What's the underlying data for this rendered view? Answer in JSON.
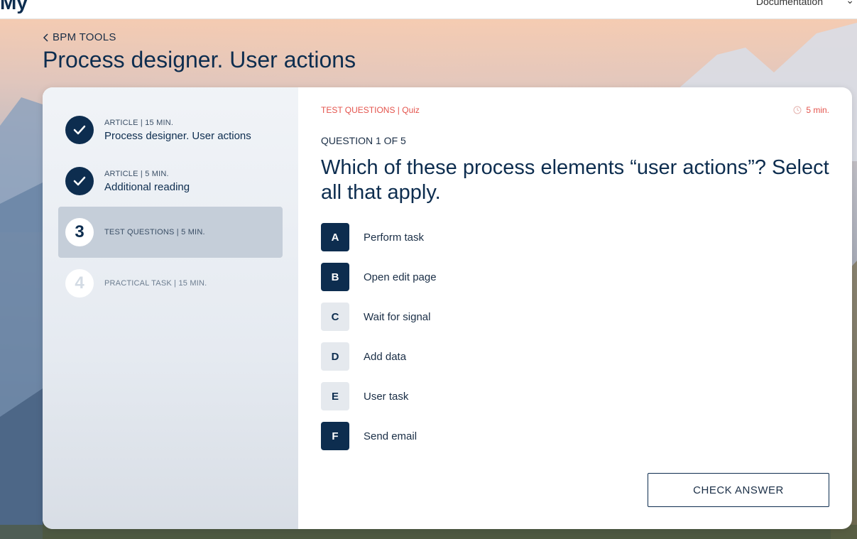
{
  "header": {
    "logo_text": "My",
    "documentation_link": "Documentation"
  },
  "breadcrumb": {
    "label": "BPM TOOLS"
  },
  "page_title": "Process designer. User actions",
  "steps": [
    {
      "kicker": "ARTICLE | 15 MIN.",
      "name": "Process designer. User actions",
      "state": "done"
    },
    {
      "kicker": "ARTICLE | 5 MIN.",
      "name": "Additional reading",
      "state": "done"
    },
    {
      "number": "3",
      "kicker": "TEST QUESTIONS | 5 MIN.",
      "state": "current"
    },
    {
      "number": "4",
      "kicker": "PRACTICAL TASK | 15 MIN.",
      "state": "todo"
    }
  ],
  "quiz": {
    "tag": "TEST QUESTIONS | Quiz",
    "duration": "5 min.",
    "counter": "QUESTION 1 OF 5",
    "question": "Which of these process elements “user actions”? Select all that apply.",
    "options": [
      {
        "letter": "A",
        "label": "Perform task",
        "selected": true
      },
      {
        "letter": "B",
        "label": "Open edit page",
        "selected": true
      },
      {
        "letter": "C",
        "label": "Wait for signal",
        "selected": false
      },
      {
        "letter": "D",
        "label": "Add data",
        "selected": false
      },
      {
        "letter": "E",
        "label": "User task",
        "selected": false
      },
      {
        "letter": "F",
        "label": "Send email",
        "selected": true
      }
    ],
    "check_button": "CHECK ANSWER"
  },
  "colors": {
    "primary": "#0d2d4f",
    "accent": "#e4544d",
    "active_step_bg": "#c5ced9"
  }
}
